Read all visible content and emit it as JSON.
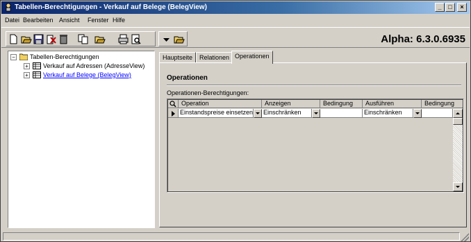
{
  "window": {
    "title": "Tabellen-Berechtigungen - Verkauf auf Belege (BelegView)",
    "controls": [
      "_",
      "□",
      "×"
    ]
  },
  "menu": [
    "Datei",
    "Bearbeiten",
    "Ansicht",
    "Fenster",
    "Hilfe"
  ],
  "toolbar": {
    "version": "Alpha: 6.3.0.6935",
    "icons": [
      "new-icon",
      "open-icon",
      "save-icon",
      "cancel-edit-icon",
      "delete-icon",
      "copy-icon",
      "open-folder-icon",
      "print-icon",
      "print-preview-icon",
      "dropdown-arrow-icon",
      "folder-open-icon"
    ]
  },
  "tree": {
    "root": "Tabellen-Berechtigungen",
    "items": [
      {
        "label": "Verkauf auf Adressen (AdresseView)",
        "link": false
      },
      {
        "label": "Verkauf auf Belege (BelegView)",
        "link": true
      }
    ]
  },
  "tabs": [
    {
      "label": "Hauptseite",
      "active": false
    },
    {
      "label": "Relationen",
      "active": false
    },
    {
      "label": "Operationen",
      "active": true
    }
  ],
  "panel": {
    "section_title": "Operationen",
    "grid_label": "Operationen-Berechtigungen:"
  },
  "grid": {
    "columns": [
      "Operation",
      "Anzeigen",
      "Bedingung",
      "Ausführen",
      "Bedingung"
    ],
    "rows": [
      [
        "Einstandspreise einsetzen",
        "Einschränken",
        "",
        "Einschränken",
        ""
      ]
    ]
  }
}
